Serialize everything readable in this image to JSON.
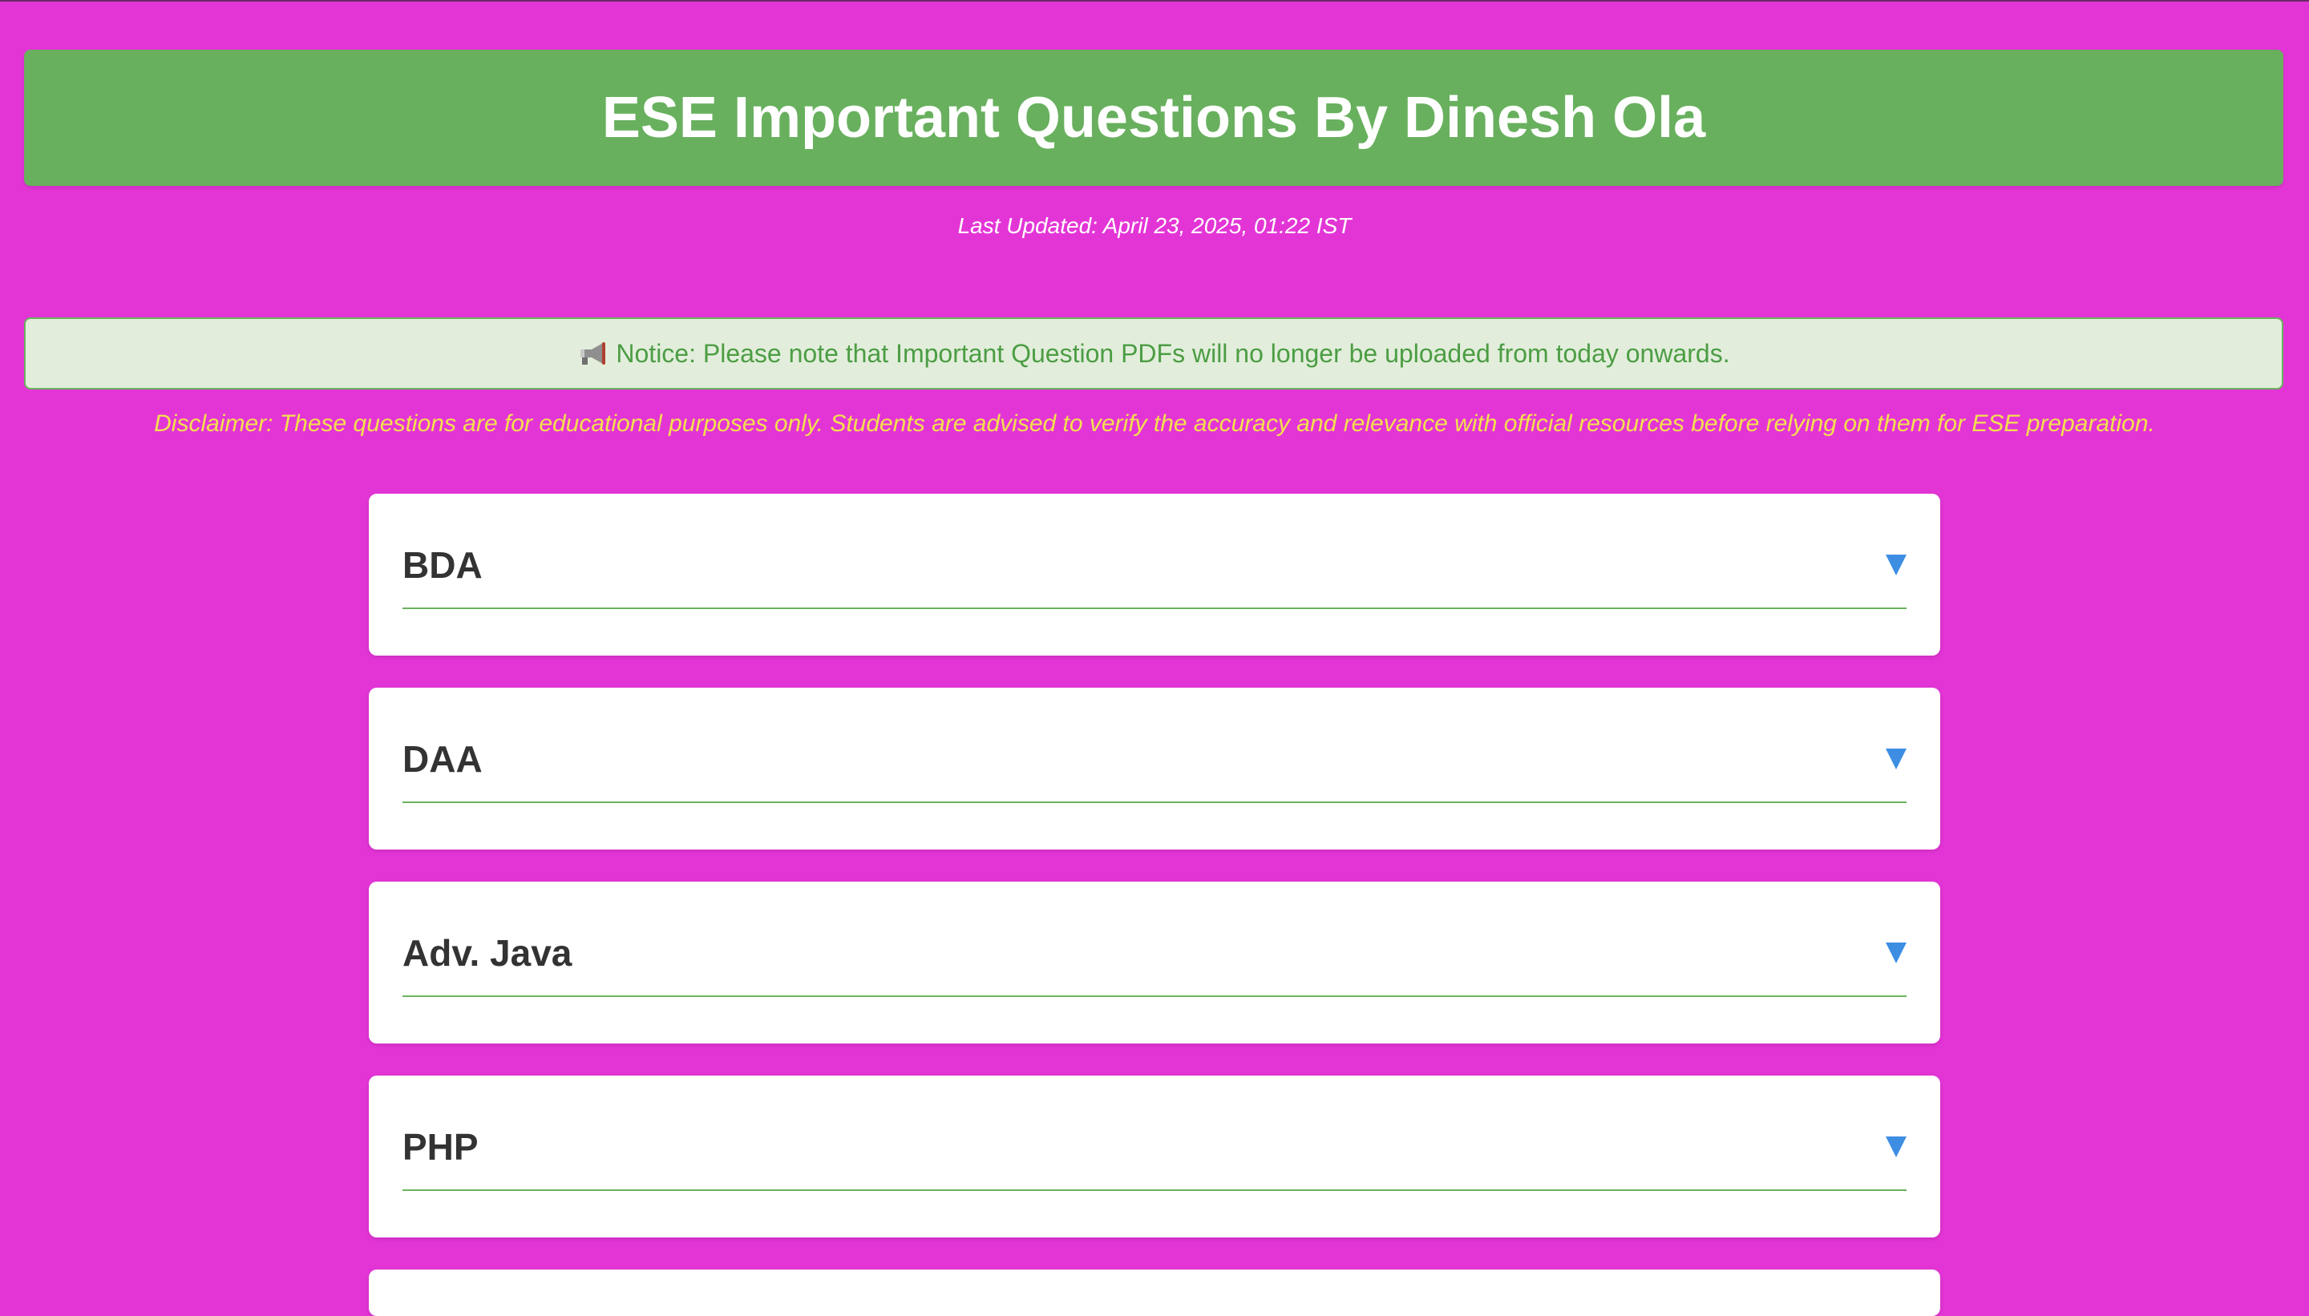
{
  "header": {
    "title": "ESE Important Questions By Dinesh Ola"
  },
  "last_updated": "Last Updated: April 23, 2025, 01:22 IST",
  "notice": {
    "icon": "megaphone-icon",
    "text": "Notice: Please note that Important Question PDFs will no longer be uploaded from today onwards."
  },
  "disclaimer": "Disclaimer: These questions are for educational purposes only. Students are advised to verify the accuracy and relevance with official resources before relying on them for ESE preparation.",
  "subjects": [
    {
      "label": "BDA",
      "icon": "chevron-down-icon"
    },
    {
      "label": "DAA",
      "icon": "chevron-down-icon"
    },
    {
      "label": "Adv. Java",
      "icon": "chevron-down-icon"
    },
    {
      "label": "PHP",
      "icon": "chevron-down-icon"
    },
    {
      "label": "",
      "icon": ""
    }
  ],
  "colors": {
    "background": "#e335d6",
    "header": "#68b05e",
    "notice_bg": "#e2eedb",
    "notice_text": "#4c9d44",
    "disclaimer": "#f3e04e",
    "chevron": "#3d8ee3"
  }
}
